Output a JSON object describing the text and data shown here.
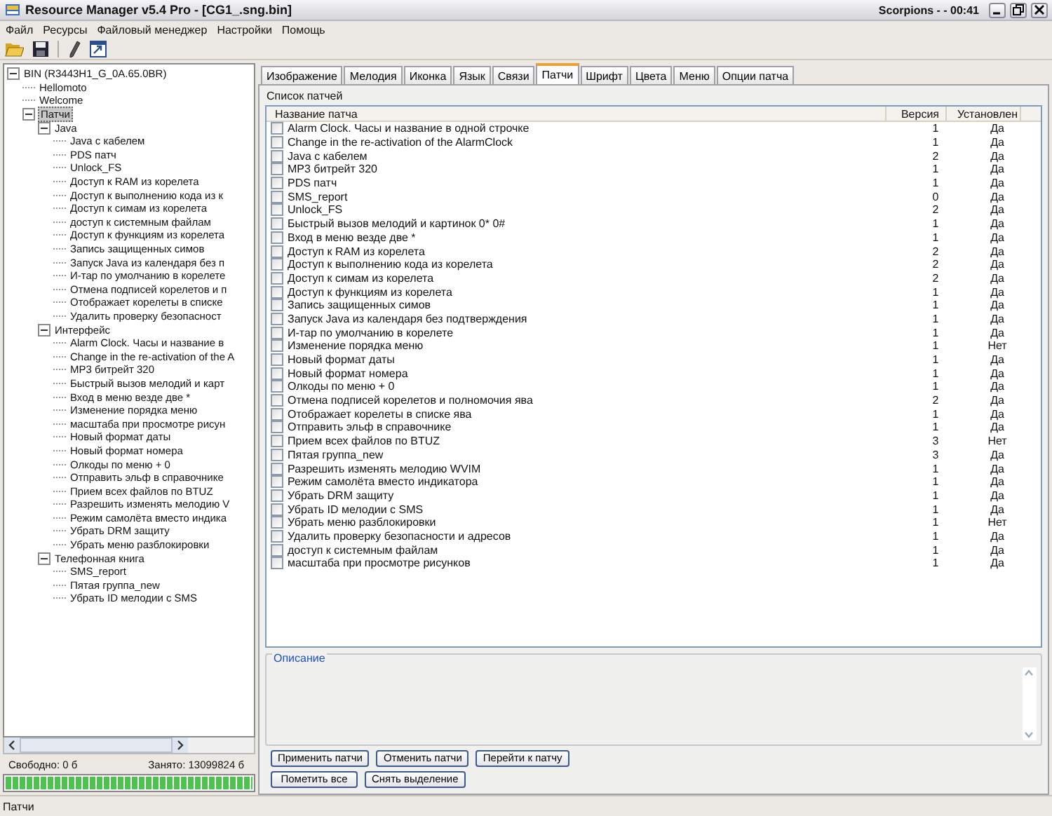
{
  "window": {
    "title": "Resource Manager v5.4 Pro - [CG1_.sng.bin]",
    "caption_right": "Scorpions - - 00:41"
  },
  "menu": [
    "Файл",
    "Ресурсы",
    "Файловый менеджер",
    "Настройки",
    "Помощь"
  ],
  "tree": [
    {
      "label": "BIN (R3443H1_G_0A.65.0BR)",
      "selected": false,
      "expanded": true,
      "children": [
        {
          "label": "Hellomoto",
          "selected": false
        },
        {
          "label": "Welcome",
          "selected": false
        },
        {
          "label": "Патчи",
          "selected": true,
          "expanded": true,
          "children": [
            {
              "label": "Java",
              "selected": false,
              "expanded": true,
              "children": [
                {
                  "label": "Java с кабелем",
                  "selected": false
                },
                {
                  "label": "PDS патч",
                  "selected": false
                },
                {
                  "label": "Unlock_FS",
                  "selected": false
                },
                {
                  "label": "Доступ к RAM из корелета",
                  "selected": false
                },
                {
                  "label": "Доступ к выполнению кода из к",
                  "selected": false
                },
                {
                  "label": "Доступ к симам из корелета",
                  "selected": false
                },
                {
                  "label": "доступ к системным файлам",
                  "selected": false
                },
                {
                  "label": "Доступ к функциям из корелета",
                  "selected": false
                },
                {
                  "label": "Запись защищенных симов",
                  "selected": false
                },
                {
                  "label": "Запуск Java из календаря без п",
                  "selected": false
                },
                {
                  "label": "И-тар по умолчанию в корелете",
                  "selected": false
                },
                {
                  "label": "Отмена подписей корелетов и п",
                  "selected": false
                },
                {
                  "label": "Отображает корелеты в списке",
                  "selected": false
                },
                {
                  "label": "Удалить проверку безопасност",
                  "selected": false
                }
              ]
            },
            {
              "label": "Интерфейс",
              "selected": false,
              "expanded": true,
              "children": [
                {
                  "label": "Alarm Clock. Часы и название в",
                  "selected": false
                },
                {
                  "label": "Change in the re-activation of the A",
                  "selected": false
                },
                {
                  "label": "MP3 битрейт 320",
                  "selected": false
                },
                {
                  "label": "Быстрый вызов мелодий и карт",
                  "selected": false
                },
                {
                  "label": "Вход в меню везде две *",
                  "selected": false
                },
                {
                  "label": "Изменение порядка меню",
                  "selected": false
                },
                {
                  "label": "масштаба при просмотре рисун",
                  "selected": false
                },
                {
                  "label": "Новый формат даты",
                  "selected": false
                },
                {
                  "label": "Новый формат номера",
                  "selected": false
                },
                {
                  "label": "Олкоды по меню + 0",
                  "selected": false
                },
                {
                  "label": "Отправить эльф в справочнике",
                  "selected": false
                },
                {
                  "label": "Прием всех файлов по BTUZ",
                  "selected": false
                },
                {
                  "label": "Разрешить изменять мелодию V",
                  "selected": false
                },
                {
                  "label": "Режим самолёта вместо индика",
                  "selected": false
                },
                {
                  "label": "Убрать DRM защиту",
                  "selected": false
                },
                {
                  "label": "Убрать меню разблокировки",
                  "selected": false
                }
              ]
            },
            {
              "label": "Телефонная книга",
              "selected": false,
              "expanded": true,
              "children": [
                {
                  "label": "SMS_report",
                  "selected": false
                },
                {
                  "label": "Пятая группа_new",
                  "selected": false
                },
                {
                  "label": "Убрать ID мелодии с SMS",
                  "selected": false
                }
              ]
            }
          ]
        }
      ]
    }
  ],
  "disk": {
    "free": "Свободно: 0 б",
    "used": "Занято: 13099824 б",
    "level": 1
  },
  "tabs": [
    {
      "label": "Изображение",
      "selected": false
    },
    {
      "label": "Мелодия",
      "selected": false
    },
    {
      "label": "Иконка",
      "selected": false
    },
    {
      "label": "Язык",
      "selected": false
    },
    {
      "label": "Связи",
      "selected": false
    },
    {
      "label": "Патчи",
      "selected": true
    },
    {
      "label": "Шрифт",
      "selected": false
    },
    {
      "label": "Цвета",
      "selected": false
    },
    {
      "label": "Меню",
      "selected": false
    },
    {
      "label": "Опции патча",
      "selected": false
    }
  ],
  "patch_list": {
    "title": "Список патчей",
    "columns": [
      "Название патча",
      "Версия",
      "Установлен"
    ],
    "rows": [
      {
        "name": "Alarm Clock. Часы и название в одной строчке",
        "checked": false,
        "version": "1",
        "installed": "Да"
      },
      {
        "name": "Change in the re-activation of the AlarmClock",
        "checked": false,
        "version": "1",
        "installed": "Да"
      },
      {
        "name": "Java с кабелем",
        "checked": false,
        "version": "2",
        "installed": "Да"
      },
      {
        "name": "MP3 битрейт 320",
        "checked": false,
        "version": "1",
        "installed": "Да"
      },
      {
        "name": "PDS патч",
        "checked": false,
        "version": "1",
        "installed": "Да"
      },
      {
        "name": "SMS_report",
        "checked": false,
        "version": "0",
        "installed": "Да"
      },
      {
        "name": "Unlock_FS",
        "checked": false,
        "version": "2",
        "installed": "Да"
      },
      {
        "name": "Быстрый вызов мелодий и картинок 0* 0#",
        "checked": false,
        "version": "1",
        "installed": "Да"
      },
      {
        "name": "Вход в меню везде две *",
        "checked": false,
        "version": "1",
        "installed": "Да"
      },
      {
        "name": "Доступ к RAM из корелета",
        "checked": false,
        "version": "2",
        "installed": "Да"
      },
      {
        "name": "Доступ к выполнению кода из корелета",
        "checked": false,
        "version": "2",
        "installed": "Да"
      },
      {
        "name": "Доступ к симам из корелета",
        "checked": false,
        "version": "2",
        "installed": "Да"
      },
      {
        "name": "Доступ к функциям из корелета",
        "checked": false,
        "version": "1",
        "installed": "Да"
      },
      {
        "name": "Запись защищенных симов",
        "checked": false,
        "version": "1",
        "installed": "Да"
      },
      {
        "name": "Запуск Java из календаря без подтверждения",
        "checked": false,
        "version": "1",
        "installed": "Да"
      },
      {
        "name": "И-тар по умолчанию в корелете",
        "checked": false,
        "version": "1",
        "installed": "Да"
      },
      {
        "name": "Изменение порядка меню",
        "checked": false,
        "version": "1",
        "installed": "Нет"
      },
      {
        "name": "Новый формат даты",
        "checked": false,
        "version": "1",
        "installed": "Да"
      },
      {
        "name": "Новый формат номера",
        "checked": false,
        "version": "1",
        "installed": "Да"
      },
      {
        "name": "Олкоды по меню + 0",
        "checked": false,
        "version": "1",
        "installed": "Да"
      },
      {
        "name": "Отмена подписей корелетов и полномочия ява",
        "checked": false,
        "version": "2",
        "installed": "Да"
      },
      {
        "name": "Отображает корелеты в списке ява",
        "checked": false,
        "version": "1",
        "installed": "Да"
      },
      {
        "name": "Отправить эльф в справочнике",
        "checked": false,
        "version": "1",
        "installed": "Да"
      },
      {
        "name": "Прием всех файлов по BTUZ",
        "checked": false,
        "version": "3",
        "installed": "Нет"
      },
      {
        "name": "Пятая группа_new",
        "checked": false,
        "version": "3",
        "installed": "Да"
      },
      {
        "name": "Разрешить изменять мелодию WVIM",
        "checked": false,
        "version": "1",
        "installed": "Да"
      },
      {
        "name": "Режим самолёта вместо индикатора",
        "checked": false,
        "version": "1",
        "installed": "Да"
      },
      {
        "name": "Убрать DRM защиту",
        "checked": false,
        "version": "1",
        "installed": "Да"
      },
      {
        "name": "Убрать ID мелодии с SMS",
        "checked": false,
        "version": "1",
        "installed": "Да"
      },
      {
        "name": "Убрать меню разблокировки",
        "checked": false,
        "version": "1",
        "installed": "Нет"
      },
      {
        "name": "Удалить проверку безопасности и адресов",
        "checked": false,
        "version": "1",
        "installed": "Да"
      },
      {
        "name": "доступ к системным файлам",
        "checked": false,
        "version": "1",
        "installed": "Да"
      },
      {
        "name": "масштаба при просмотре рисунков",
        "checked": false,
        "version": "1",
        "installed": "Да"
      }
    ]
  },
  "description": {
    "title": "Описание"
  },
  "button_rows": [
    [
      "Применить патчи",
      "Отменить патчи",
      "Перейти к патчу"
    ],
    [
      "Пометить все",
      "Снять выделение"
    ]
  ],
  "status_bar": "Патчи"
}
